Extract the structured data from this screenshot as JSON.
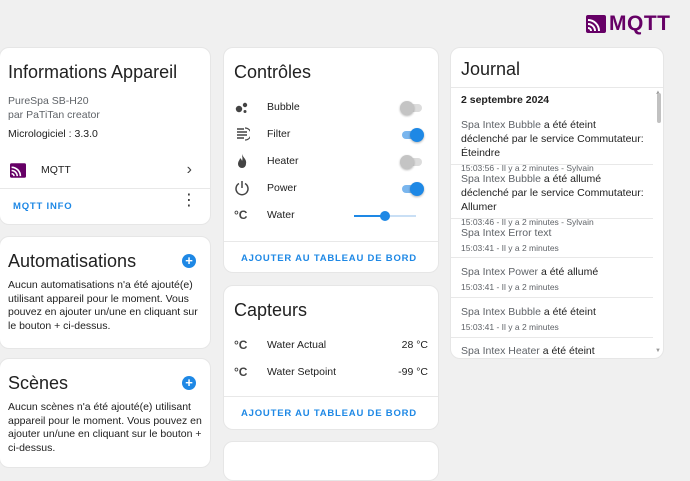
{
  "brand": {
    "logo_text": "MQTT",
    "color": "#660066"
  },
  "device": {
    "title": "Informations Appareil",
    "model": "PureSpa SB-H20",
    "manufacturer": "par PaTiTan creator",
    "firmware": "Micrologiciel : 3.3.0",
    "integration": "MQTT",
    "info_button": "MQTT INFO"
  },
  "automations": {
    "title": "Automatisations",
    "empty_text": "Aucun automatisations n'a été ajouté(e) utilisant appareil pour le moment. Vous pouvez en ajouter un/une en cliquant sur le bouton + ci-dessus."
  },
  "scenes": {
    "title": "Scènes",
    "empty_text": "Aucun scènes n'a été ajouté(e) utilisant appareil pour le moment. Vous pouvez en ajouter un/une en cliquant sur le bouton + ci-dessus."
  },
  "controls": {
    "title": "Contrôles",
    "items": [
      {
        "label": "Bubble",
        "icon": "bubble-icon",
        "state": "off"
      },
      {
        "label": "Filter",
        "icon": "filter-icon",
        "state": "on"
      },
      {
        "label": "Heater",
        "icon": "fire-icon",
        "state": "off"
      },
      {
        "label": "Power",
        "icon": "power-icon",
        "state": "on"
      },
      {
        "label": "Water",
        "icon": "thermometer-celsius-icon",
        "slider_fraction": 0.5
      }
    ],
    "add_dashboard": "AJOUTER AU TABLEAU DE BORD"
  },
  "sensors": {
    "title": "Capteurs",
    "items": [
      {
        "label": "Water Actual",
        "value": "28 °C",
        "icon": "celsius-icon"
      },
      {
        "label": "Water Setpoint",
        "value": "-99 °C",
        "icon": "celsius-icon"
      }
    ],
    "add_dashboard": "AJOUTER AU TABLEAU DE BORD"
  },
  "journal": {
    "title": "Journal",
    "date": "2 septembre 2024",
    "entries": [
      {
        "entity": "Spa Intex Bubble",
        "text": " a été éteint déclenché par le service Commutateur: Éteindre",
        "meta": "15:03:56 - Il y a 2 minutes - Sylvain"
      },
      {
        "entity": "Spa Intex Bubble",
        "text": " a été allumé déclenché par le service Commutateur: Allumer",
        "meta": "15:03:46 - Il y a 2 minutes - Sylvain"
      },
      {
        "entity": "Spa Intex Error text",
        "text": "",
        "meta": "15:03:41 - Il y a 2 minutes"
      },
      {
        "entity": "Spa Intex Power",
        "text": " a été allumé",
        "meta": "15:03:41 - Il y a 2 minutes"
      },
      {
        "entity": "Spa Intex Bubble",
        "text": " a été éteint",
        "meta": "15:03:41 - Il y a 2 minutes"
      },
      {
        "entity": "Spa Intex Heater",
        "text": " a été éteint",
        "meta": ""
      }
    ]
  },
  "colors": {
    "accent": "#1e88e5",
    "background": "#f0f0f0"
  }
}
